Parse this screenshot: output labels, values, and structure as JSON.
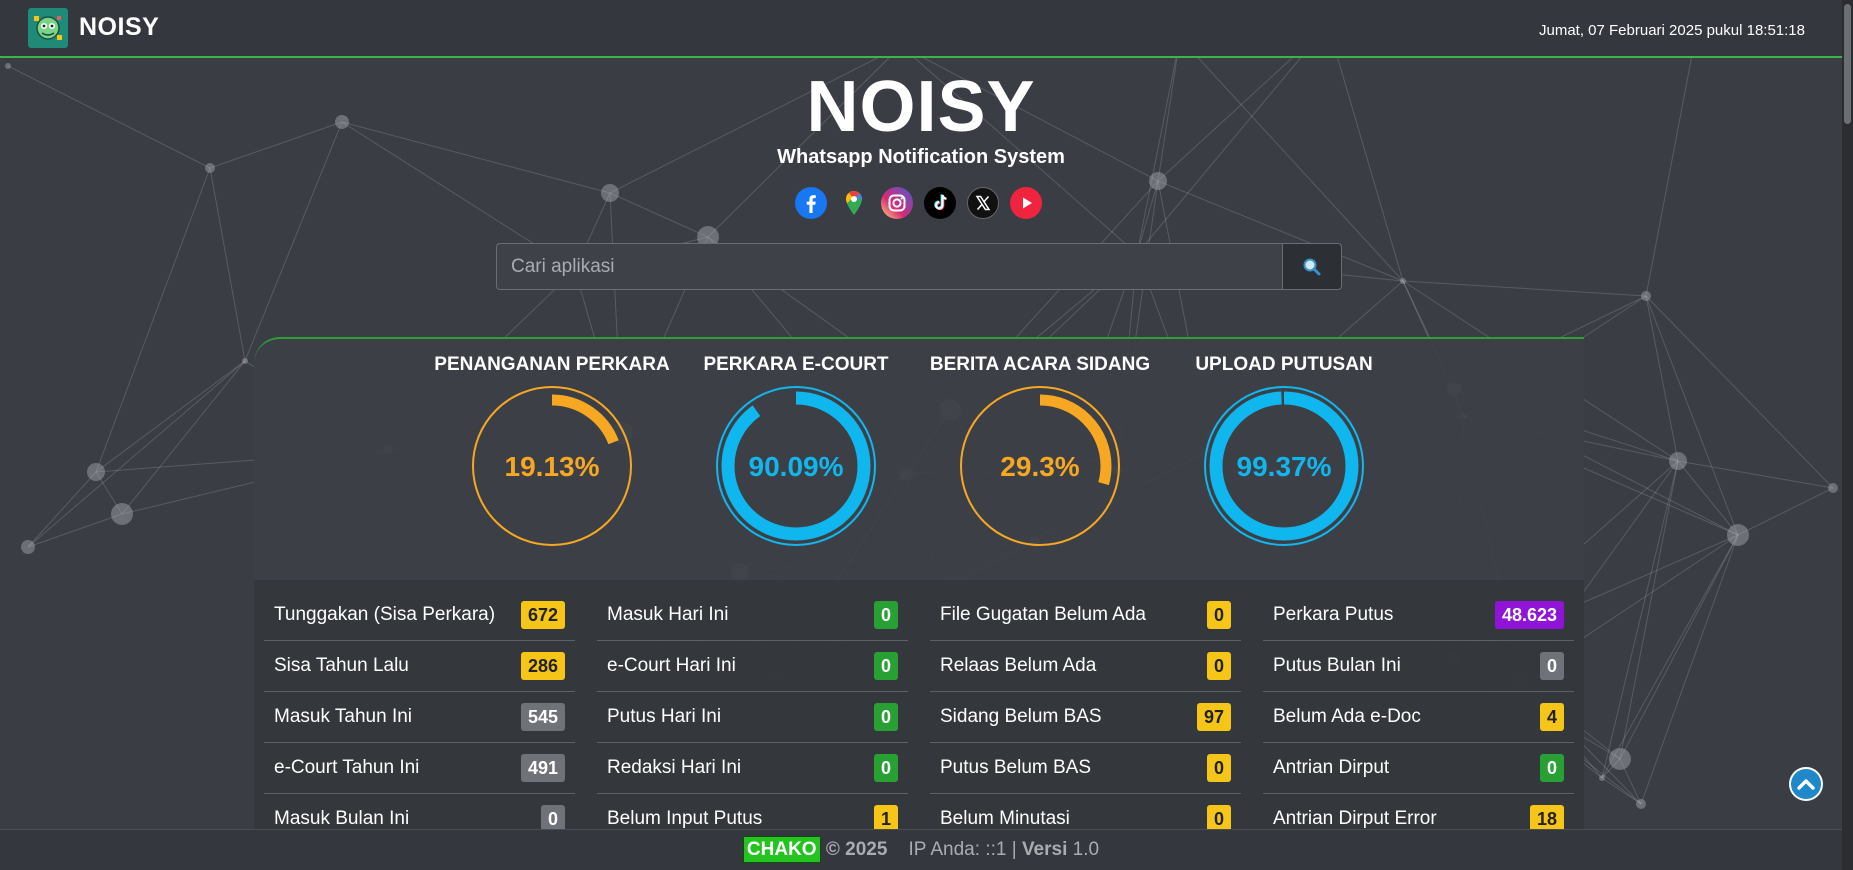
{
  "header": {
    "brand": "NOISY",
    "datetime": "Jumat, 07 Februari 2025 pukul 18:51:18"
  },
  "hero": {
    "title": "NOISY",
    "subtitle": "Whatsapp Notification System"
  },
  "socials": [
    {
      "icon": "facebook-icon",
      "color": "#1877f2"
    },
    {
      "icon": "google-maps-icon",
      "color": "#34a853"
    },
    {
      "icon": "instagram-icon",
      "color": "#e1306c"
    },
    {
      "icon": "tiktok-icon",
      "color": "#000000"
    },
    {
      "icon": "x-icon",
      "color": "#000000"
    },
    {
      "icon": "youtube-icon",
      "color": "#ff0000"
    }
  ],
  "search": {
    "placeholder": "Cari aplikasi",
    "value": ""
  },
  "gauges": [
    {
      "title": "PENANGANAN PERKARA",
      "value": "19.13%",
      "percent": 19.13,
      "color": "#f7a823",
      "style": "thin"
    },
    {
      "title": "PERKARA E-COURT",
      "value": "90.09%",
      "percent": 90.09,
      "color": "#10b7ee",
      "style": "thick"
    },
    {
      "title": "BERITA ACARA SIDANG",
      "value": "29.3%",
      "percent": 29.3,
      "color": "#f7a823",
      "style": "thin"
    },
    {
      "title": "UPLOAD PUTUSAN",
      "value": "99.37%",
      "percent": 99.37,
      "color": "#10b7ee",
      "style": "thick"
    }
  ],
  "stats": [
    [
      {
        "label": "Tunggakan (Sisa Perkara)",
        "value": "672",
        "color": "yellow"
      },
      {
        "label": "Sisa Tahun Lalu",
        "value": "286",
        "color": "yellow"
      },
      {
        "label": "Masuk Tahun Ini",
        "value": "545",
        "color": "gray"
      },
      {
        "label": "e-Court Tahun Ini",
        "value": "491",
        "color": "gray"
      },
      {
        "label": "Masuk Bulan Ini",
        "value": "0",
        "color": "gray"
      }
    ],
    [
      {
        "label": "Masuk Hari Ini",
        "value": "0",
        "color": "green"
      },
      {
        "label": "e-Court Hari Ini",
        "value": "0",
        "color": "green"
      },
      {
        "label": "Putus Hari Ini",
        "value": "0",
        "color": "green"
      },
      {
        "label": "Redaksi Hari Ini",
        "value": "0",
        "color": "green"
      },
      {
        "label": "Belum Input Putus",
        "value": "1",
        "color": "yellow"
      }
    ],
    [
      {
        "label": "File Gugatan Belum Ada",
        "value": "0",
        "color": "yellow"
      },
      {
        "label": "Relaas Belum Ada",
        "value": "0",
        "color": "yellow"
      },
      {
        "label": "Sidang Belum BAS",
        "value": "97",
        "color": "yellow"
      },
      {
        "label": "Putus Belum BAS",
        "value": "0",
        "color": "yellow"
      },
      {
        "label": "Belum Minutasi",
        "value": "0",
        "color": "yellow"
      }
    ],
    [
      {
        "label": "Perkara Putus",
        "value": "48.623",
        "color": "purple"
      },
      {
        "label": "Putus Bulan Ini",
        "value": "0",
        "color": "gray"
      },
      {
        "label": "Belum Ada e-Doc",
        "value": "4",
        "color": "yellow"
      },
      {
        "label": "Antrian Dirput",
        "value": "0",
        "color": "green"
      },
      {
        "label": "Antrian Dirput Error",
        "value": "18",
        "color": "yellow"
      }
    ]
  ],
  "footer": {
    "brand": "CHAKO",
    "copyright": "© 2025",
    "ip_label": "IP Anda: ::1",
    "separator": "|",
    "version_label": "Versi",
    "version": "1.0"
  }
}
